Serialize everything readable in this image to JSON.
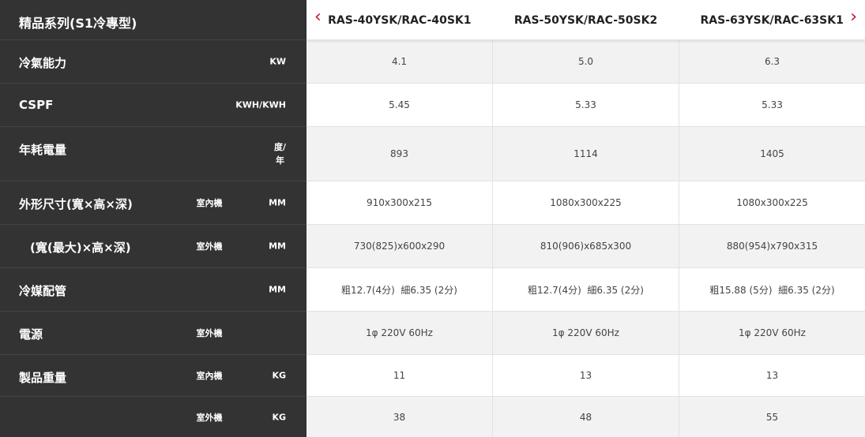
{
  "header": {
    "series_title": "精品系列(S1冷專型)",
    "prev_icon": "chevron-left-icon",
    "next_icon": "chevron-right-icon",
    "models": [
      "RAS-40YSK/RAC-40SK1",
      "RAS-50YSK/RAC-50SK2",
      "RAS-63YSK/RAC-63SK1"
    ]
  },
  "colors": {
    "accent": "#c8102e",
    "sidebar_bg": "#333333",
    "row_alt_bg": "#f2f2f2"
  },
  "rows": [
    {
      "title": "冷氣能力",
      "sub": "",
      "unit": "KW",
      "values": [
        "4.1",
        "5.0",
        "6.3"
      ]
    },
    {
      "title": "CSPF",
      "sub": "",
      "unit": "KWH/KWH",
      "values": [
        "5.45",
        "5.33",
        "5.33"
      ]
    },
    {
      "title": "年耗電量",
      "sub": "",
      "unit": "度/\n年",
      "values": [
        "893",
        "1114",
        "1405"
      ]
    },
    {
      "title": "外形尺寸(寬×高×深)",
      "sub": "室內機",
      "unit": "MM",
      "values": [
        "910x300x215",
        "1080x300x225",
        "1080x300x225"
      ]
    },
    {
      "title": "(寬(最大)×高×深)",
      "sub": "室外機",
      "unit": "MM",
      "values": [
        "730(825)x600x290",
        "810(906)x685x300",
        "880(954)x790x315"
      ]
    },
    {
      "title": "冷媒配管",
      "sub": "",
      "unit": "MM",
      "values": [
        "粗12.7(4分)  細6.35 (2分)",
        "粗12.7(4分)  細6.35 (2分)",
        "粗15.88 (5分)  細6.35 (2分)"
      ]
    },
    {
      "title": "電源",
      "sub": "室外機",
      "unit": "",
      "values": [
        "1φ 220V 60Hz",
        "1φ 220V 60Hz",
        "1φ 220V 60Hz"
      ]
    },
    {
      "title": "製品重量",
      "sub": "室內機",
      "unit": "KG",
      "values": [
        "11",
        "13",
        "13"
      ]
    },
    {
      "title": "",
      "sub": "室外機",
      "unit": "KG",
      "values": [
        "38",
        "48",
        "55"
      ]
    }
  ]
}
